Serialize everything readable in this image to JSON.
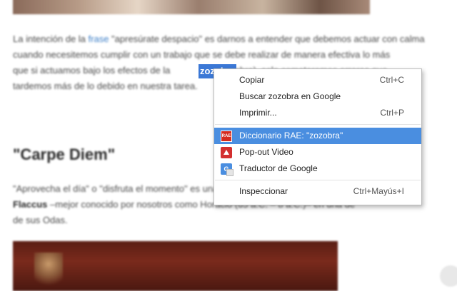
{
  "article": {
    "p1_line1_before": "La intención de la ",
    "p1_link": "frase",
    "p1_line1_after": " \"apresúrate despacio\" es darnos a entender que debemos actuar con calma",
    "p1_line2": "cuando necesitemos cumplir con un trabajo que se debe realizar de manera efectiva lo más",
    "p1_line3_before": "que si actuamos bajo los efectos de la",
    "p1_line3_after": " (zozobra), solo cometeremos errores que",
    "p1_line4": "tardemos más de lo debido en nuestra tarea.",
    "selected_word": "zozobra",
    "heading": "\"Carpe Diem\"",
    "p2_line1": "\"Aprovecha el día\" o \"disfruta el momento\" es una frase del poeta romano Horacio",
    "p2_line2_bold": "Flaccus",
    "p2_line2_rest": " –mejor conocido por nosotros como Horacio (65 a.C. – 8 a.C.)– en una de",
    "p2_line3": "de sus Odas."
  },
  "context_menu": {
    "items": [
      {
        "label": "Copiar",
        "shortcut": "Ctrl+C"
      },
      {
        "label": "Buscar zozobra en Google",
        "shortcut": ""
      },
      {
        "label": "Imprimir...",
        "shortcut": "Ctrl+P"
      },
      {
        "label": "Diccionario RAE: \"zozobra\"",
        "shortcut": "",
        "icon": "rae-dictionary-icon",
        "highlighted": true,
        "icon_text": "RAE"
      },
      {
        "label": "Pop-out Video",
        "shortcut": "",
        "icon": "popout-video-icon"
      },
      {
        "label": "Traductor de Google",
        "shortcut": "",
        "icon": "google-translate-icon",
        "icon_text": "G"
      },
      {
        "label": "Inspeccionar",
        "shortcut": "Ctrl+Mayús+I"
      }
    ]
  },
  "colors": {
    "highlight": "#4a8ee0",
    "selection": "#3b78d6",
    "link": "#3d7fc7"
  }
}
